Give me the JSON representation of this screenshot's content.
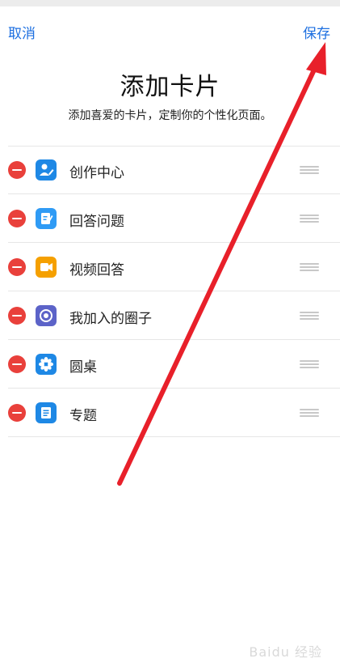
{
  "header": {
    "cancel_label": "取消",
    "save_label": "保存"
  },
  "page": {
    "title": "添加卡片",
    "subtitle": "添加喜爱的卡片，定制你的个性化页面。"
  },
  "cards": [
    {
      "label": "创作中心",
      "icon": "creator-center-icon",
      "color": "#1e88e5"
    },
    {
      "label": "回答问题",
      "icon": "answer-question-icon",
      "color": "#2f9bf5"
    },
    {
      "label": "视频回答",
      "icon": "video-answer-icon",
      "color": "#f5a000"
    },
    {
      "label": "我加入的圈子",
      "icon": "circle-icon",
      "color": "#5c63c8"
    },
    {
      "label": "圆桌",
      "icon": "roundtable-icon",
      "color": "#1e88e5"
    },
    {
      "label": "专题",
      "icon": "topic-icon",
      "color": "#1e88e5"
    }
  ],
  "annotation": {
    "arrow_color": "#e8202a"
  },
  "watermark": "Baidu 经验"
}
